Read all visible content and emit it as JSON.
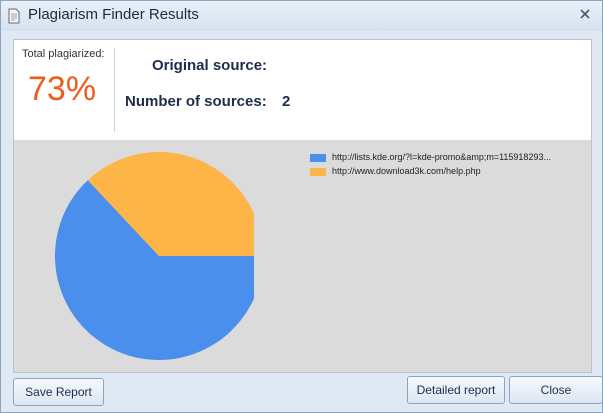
{
  "window": {
    "title": "Plagiarism Finder Results"
  },
  "stats": {
    "total_label": "Total plagiarized:",
    "total_value": "73%",
    "original_source_label": "Original source:",
    "num_sources_label": "Number of sources:",
    "num_sources_value": "2"
  },
  "chart_data": {
    "type": "pie",
    "series": [
      {
        "name": "http://lists.kde.org/?l=kde-promo&amp;m=115918293...",
        "value": 63,
        "color": "#4a8fec"
      },
      {
        "name": "http://www.download3k.com/help.php",
        "value": 37,
        "color": "#fdb548"
      }
    ],
    "legend_placement": "top-right"
  },
  "buttons": {
    "save_report": "Save Report",
    "detailed_report": "Detailed report",
    "close": "Close"
  },
  "icons": {
    "app": "document-icon",
    "close": "close-icon"
  }
}
